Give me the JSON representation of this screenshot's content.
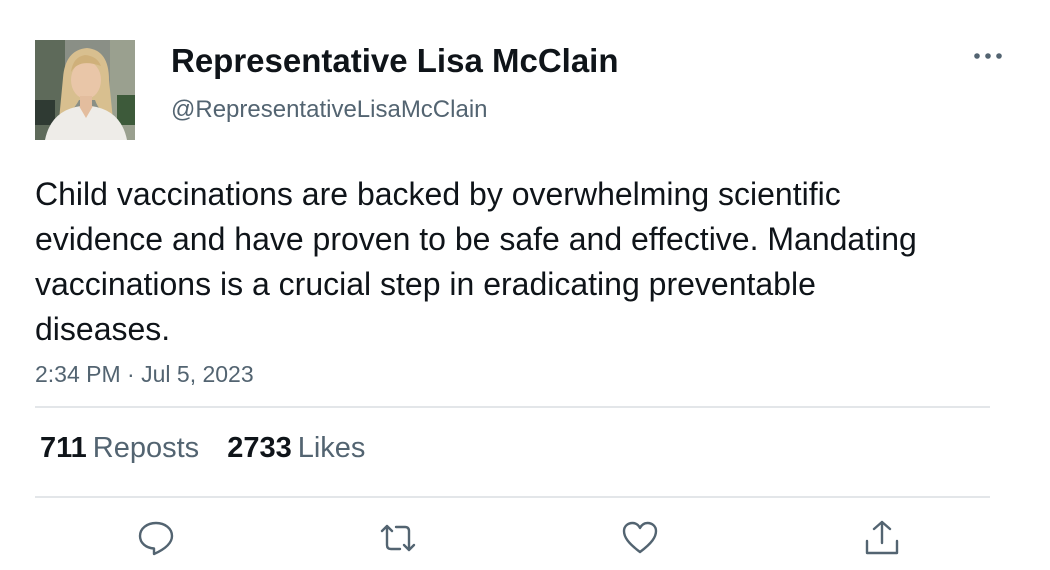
{
  "author": {
    "display_name": "Representative Lisa McClain",
    "handle": "@RepresentativeLisaMcClain"
  },
  "tweet": {
    "text": "Child vaccinations are backed by overwhelming scientific evidence and have proven to be safe and effective. Mandating vaccinations is a crucial step in eradicating preventable diseases.",
    "time": "2:34 PM",
    "separator": "·",
    "date": "Jul 5, 2023"
  },
  "stats": {
    "reposts_count": "711",
    "reposts_label": "Reposts",
    "likes_count": "2733",
    "likes_label": "Likes"
  },
  "icons": {
    "more": "more-options-icon",
    "reply": "reply-icon",
    "repost": "repost-icon",
    "like": "like-icon",
    "share": "share-icon"
  },
  "colors": {
    "text_primary": "#0f1419",
    "text_secondary": "#536471",
    "divider": "#e3e6e9"
  }
}
